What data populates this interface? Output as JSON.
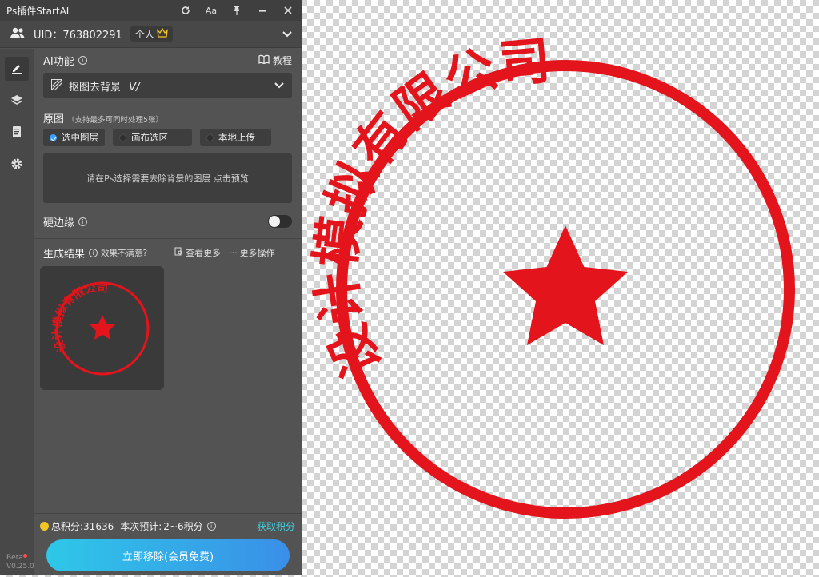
{
  "canvas": {
    "stamp_text": "设计模拟有限公司"
  },
  "plugin": {
    "title": "Ps插件StartAI",
    "titlebar_icons": [
      "refresh-icon",
      "font-size-icon",
      "pin-icon",
      "minimize-icon",
      "close-icon"
    ],
    "font_icon_text": "Aa",
    "uid_text": "UID：763802291",
    "badge_label": "个人",
    "ai_section": {
      "label": "AI功能",
      "tutorial": "教程",
      "selected_feature": "抠图去背景",
      "feature_tag": "V/"
    },
    "original": {
      "label": "原图",
      "hint": "（支持最多可同时处理5张）",
      "sources": [
        {
          "label": "选中图层",
          "selected": true
        },
        {
          "label": "画布选区",
          "selected": false
        },
        {
          "label": "本地上传",
          "selected": false
        }
      ],
      "empty_hint": "请在Ps选择需要去除背景的图层 点击预览"
    },
    "hard_edge": {
      "label": "硬边缘",
      "enabled": false
    },
    "result": {
      "label": "生成结果",
      "unsatisfied": "效果不满意?",
      "view_more": "查看更多",
      "more_ops": "更多操作"
    },
    "footer": {
      "total_points": "总积分:31636",
      "estimate_label": "本次预计:",
      "estimate_value": "2~6积分",
      "get_points": "获取积分",
      "cta": "立即移除(会员免费)"
    },
    "beta_label": "Beta",
    "version": "V0.25.0",
    "colors": {
      "accent_blue": "#3aa0ff",
      "link_cyan": "#3fd0e0",
      "stamp_red": "#e3141b",
      "coin_gold": "#f3c623"
    }
  }
}
